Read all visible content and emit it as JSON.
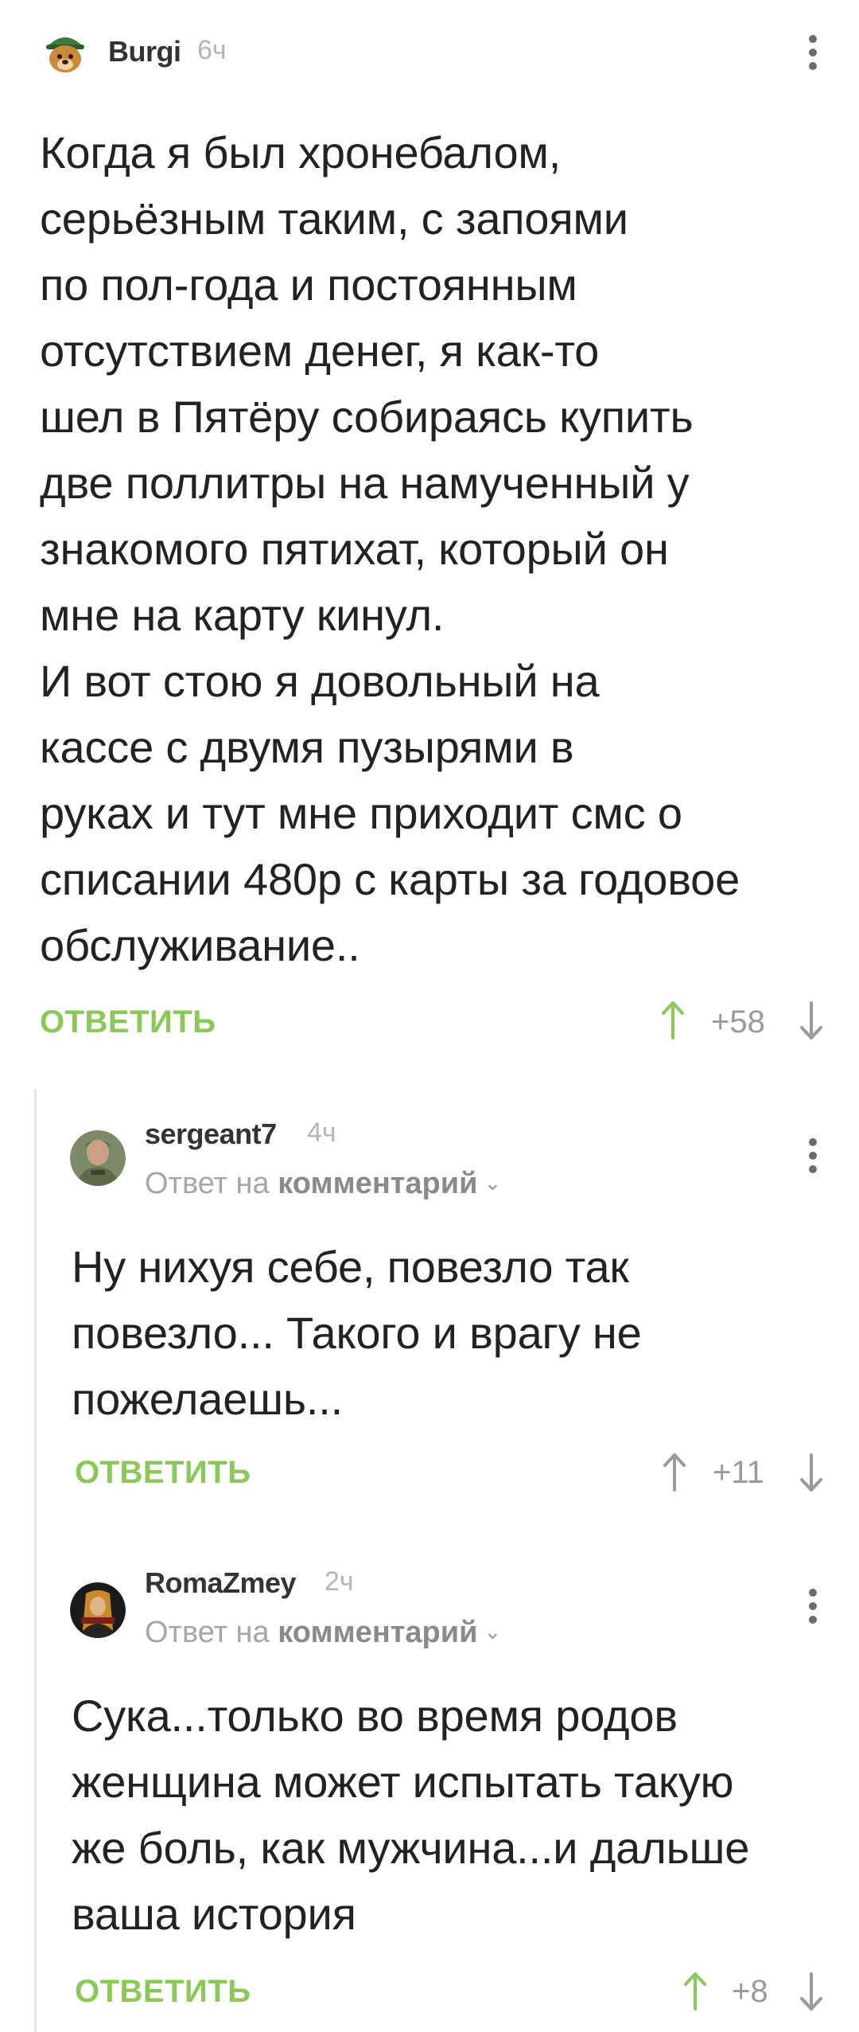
{
  "comments": [
    {
      "username": "Burgi",
      "time": "6ч",
      "text": "Когда я был хронебалом,\nсерьёзным таким, с запоями\nпо пол-года и постоянным\nотсутствием денег, я как-то\nшел в Пятёру собираясь купить\nдве поллитры на намученный у\nзнакомого пятихат, который он\nмне на карту кинул.\nИ вот стою я довольный на\nкассе с двумя пузырями в\nруках и тут мне приходит смс о\nсписании 480р с карты за годовое\nобслуживание..",
      "reply_label": "ОТВЕТИТЬ",
      "rating": "+58"
    },
    {
      "username": "sergeant7",
      "time": "4ч",
      "reply_prefix": "Ответ на",
      "reply_target": "комментарий",
      "text": "Ну нихуя себе, повезло так\nповезло... Такого и врагу не\nпожелаешь...",
      "reply_label": "ОТВЕТИТЬ",
      "rating": "+11"
    },
    {
      "username": "RomaZmey",
      "time": "2ч",
      "reply_prefix": "Ответ на",
      "reply_target": "комментарий",
      "text": "Сука...только во время родов\nженщина может испытать такую\nже боль, как мужчина...и дальше\nваша история",
      "reply_label": "ОТВЕТИТЬ",
      "rating": "+8"
    }
  ],
  "colors": {
    "accent_green": "#8ac858",
    "vote_up_active": "#8ac858",
    "vote_neutral": "#9a9a9a",
    "username": "#333333",
    "muted": "#b5b5b5"
  },
  "icons": {
    "menu": "more-vertical-icon",
    "up": "arrow-up-icon",
    "down": "arrow-down-icon"
  }
}
